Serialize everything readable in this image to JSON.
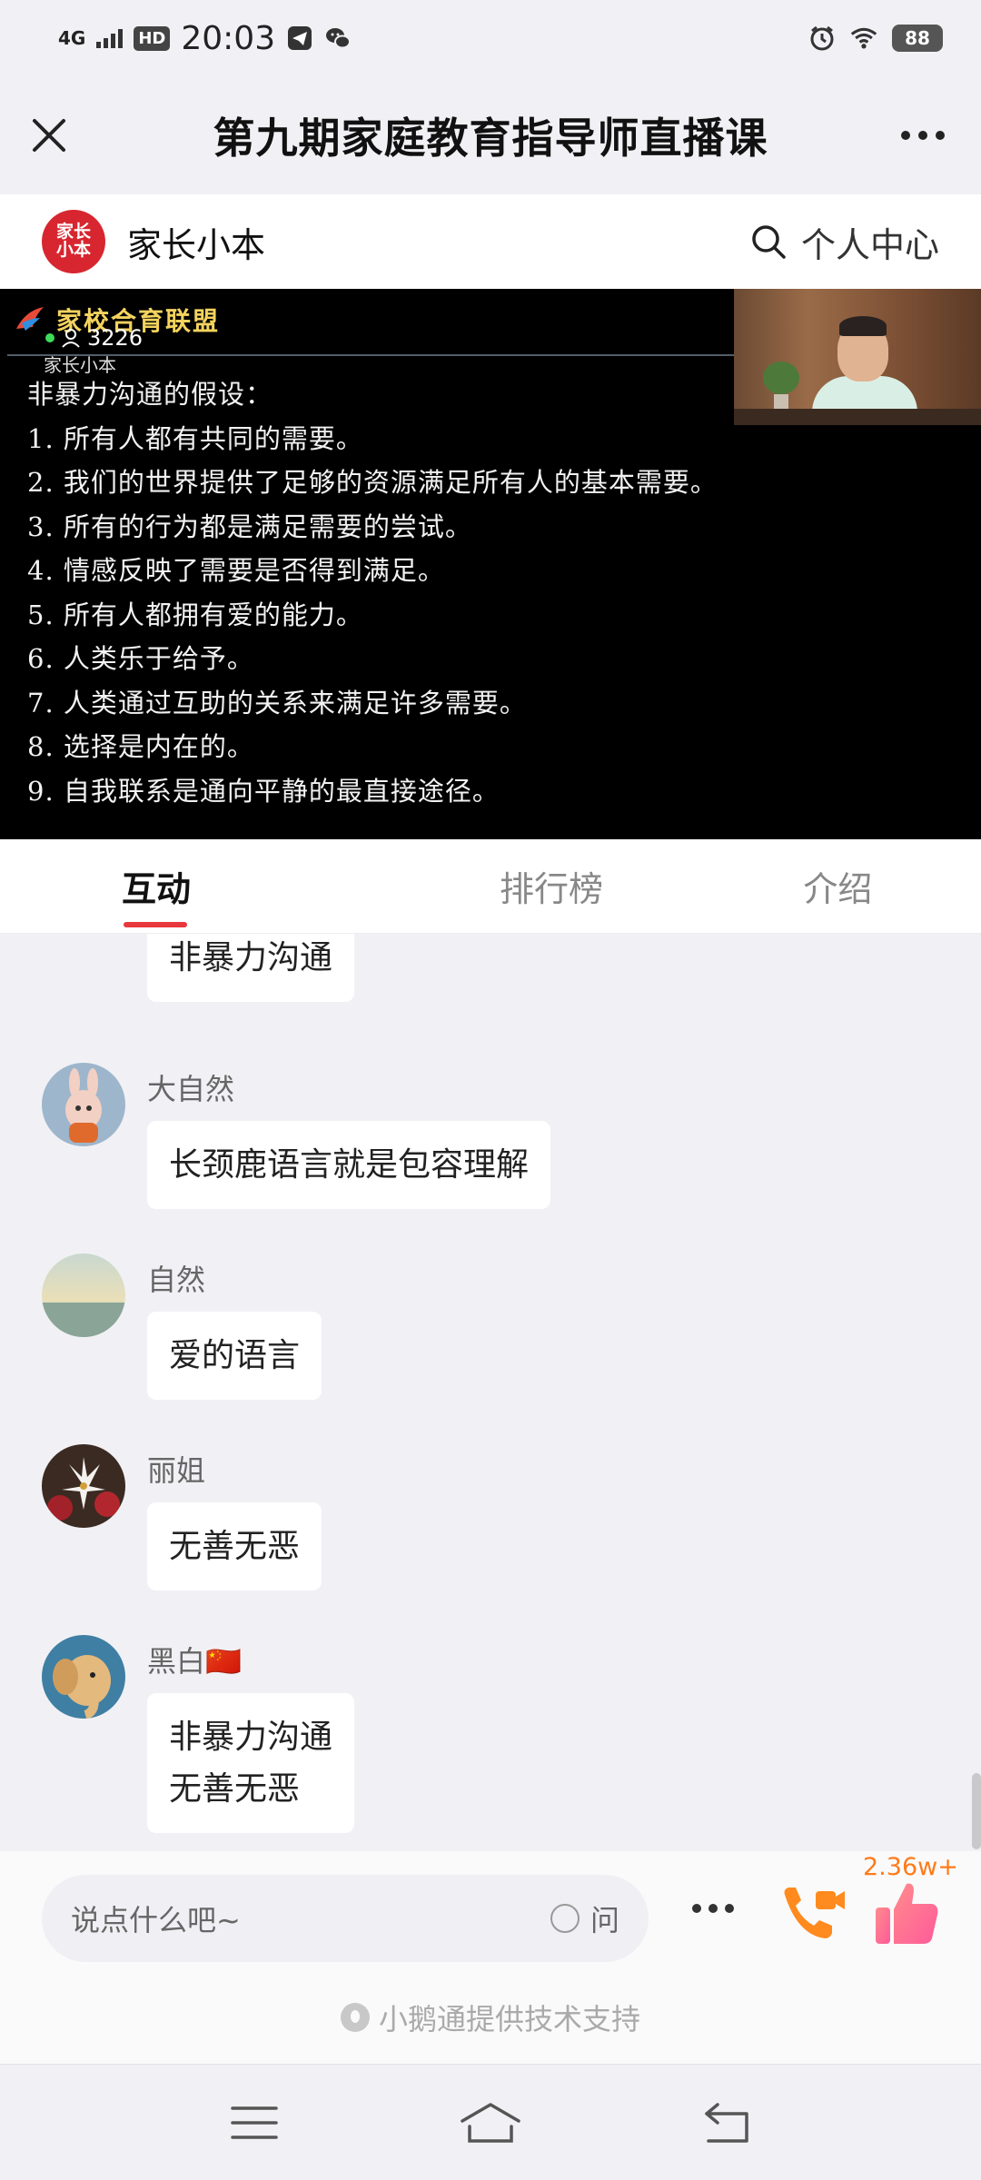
{
  "status_bar": {
    "network": "4G",
    "hd_badge": "HD",
    "time": "20:03",
    "battery": "88"
  },
  "title_bar": {
    "title": "第九期家庭教育指导师直播课"
  },
  "channel": {
    "logo_line1": "家长",
    "logo_line2": "小本",
    "name": "家长小本",
    "personal_center": "个人中心"
  },
  "video": {
    "watermark": "家校合育联盟",
    "viewer_count": "3226",
    "channel_mark": "家长小本",
    "slide_heading": "非暴力沟通的假设：",
    "slide_lines": [
      "1. 所有人都有共同的需要。",
      "2. 我们的世界提供了足够的资源满足所有人的基本需要。",
      "3. 所有的行为都是满足需要的尝试。",
      "4. 情感反映了需要是否得到满足。",
      "5. 所有人都拥有爱的能力。",
      "6. 人类乐于给予。",
      "7. 人类通过互助的关系来满足许多需要。",
      "8. 选择是内在的。",
      "9. 自我联系是通向平静的最直接途径。"
    ]
  },
  "tabs": [
    {
      "label": "互动",
      "active": true
    },
    {
      "label": "排行榜",
      "active": false
    },
    {
      "label": "介绍",
      "active": false
    }
  ],
  "messages": [
    {
      "name": "",
      "text": "非暴力沟通",
      "avatar": "partial"
    },
    {
      "name": "大自然",
      "text": "长颈鹿语言就是包容理解",
      "avatar": "cartoon-rabbit"
    },
    {
      "name": "自然",
      "text": "爱的语言",
      "avatar": "sunset-sea"
    },
    {
      "name": "丽姐",
      "text": "无善无恶",
      "avatar": "white-lily"
    },
    {
      "name": "黑白🇨🇳",
      "text": "非暴力沟通\n无善无恶",
      "avatar": "cartoon-elephant"
    }
  ],
  "composer": {
    "placeholder": "说点什么吧~",
    "ask_label": "问",
    "like_count": "2.36w+",
    "powered_by": "小鹅通提供技术支持"
  },
  "colors": {
    "accent_red": "#e8383d",
    "logo_red": "#d7262f",
    "like_orange": "#ff7a1a"
  }
}
